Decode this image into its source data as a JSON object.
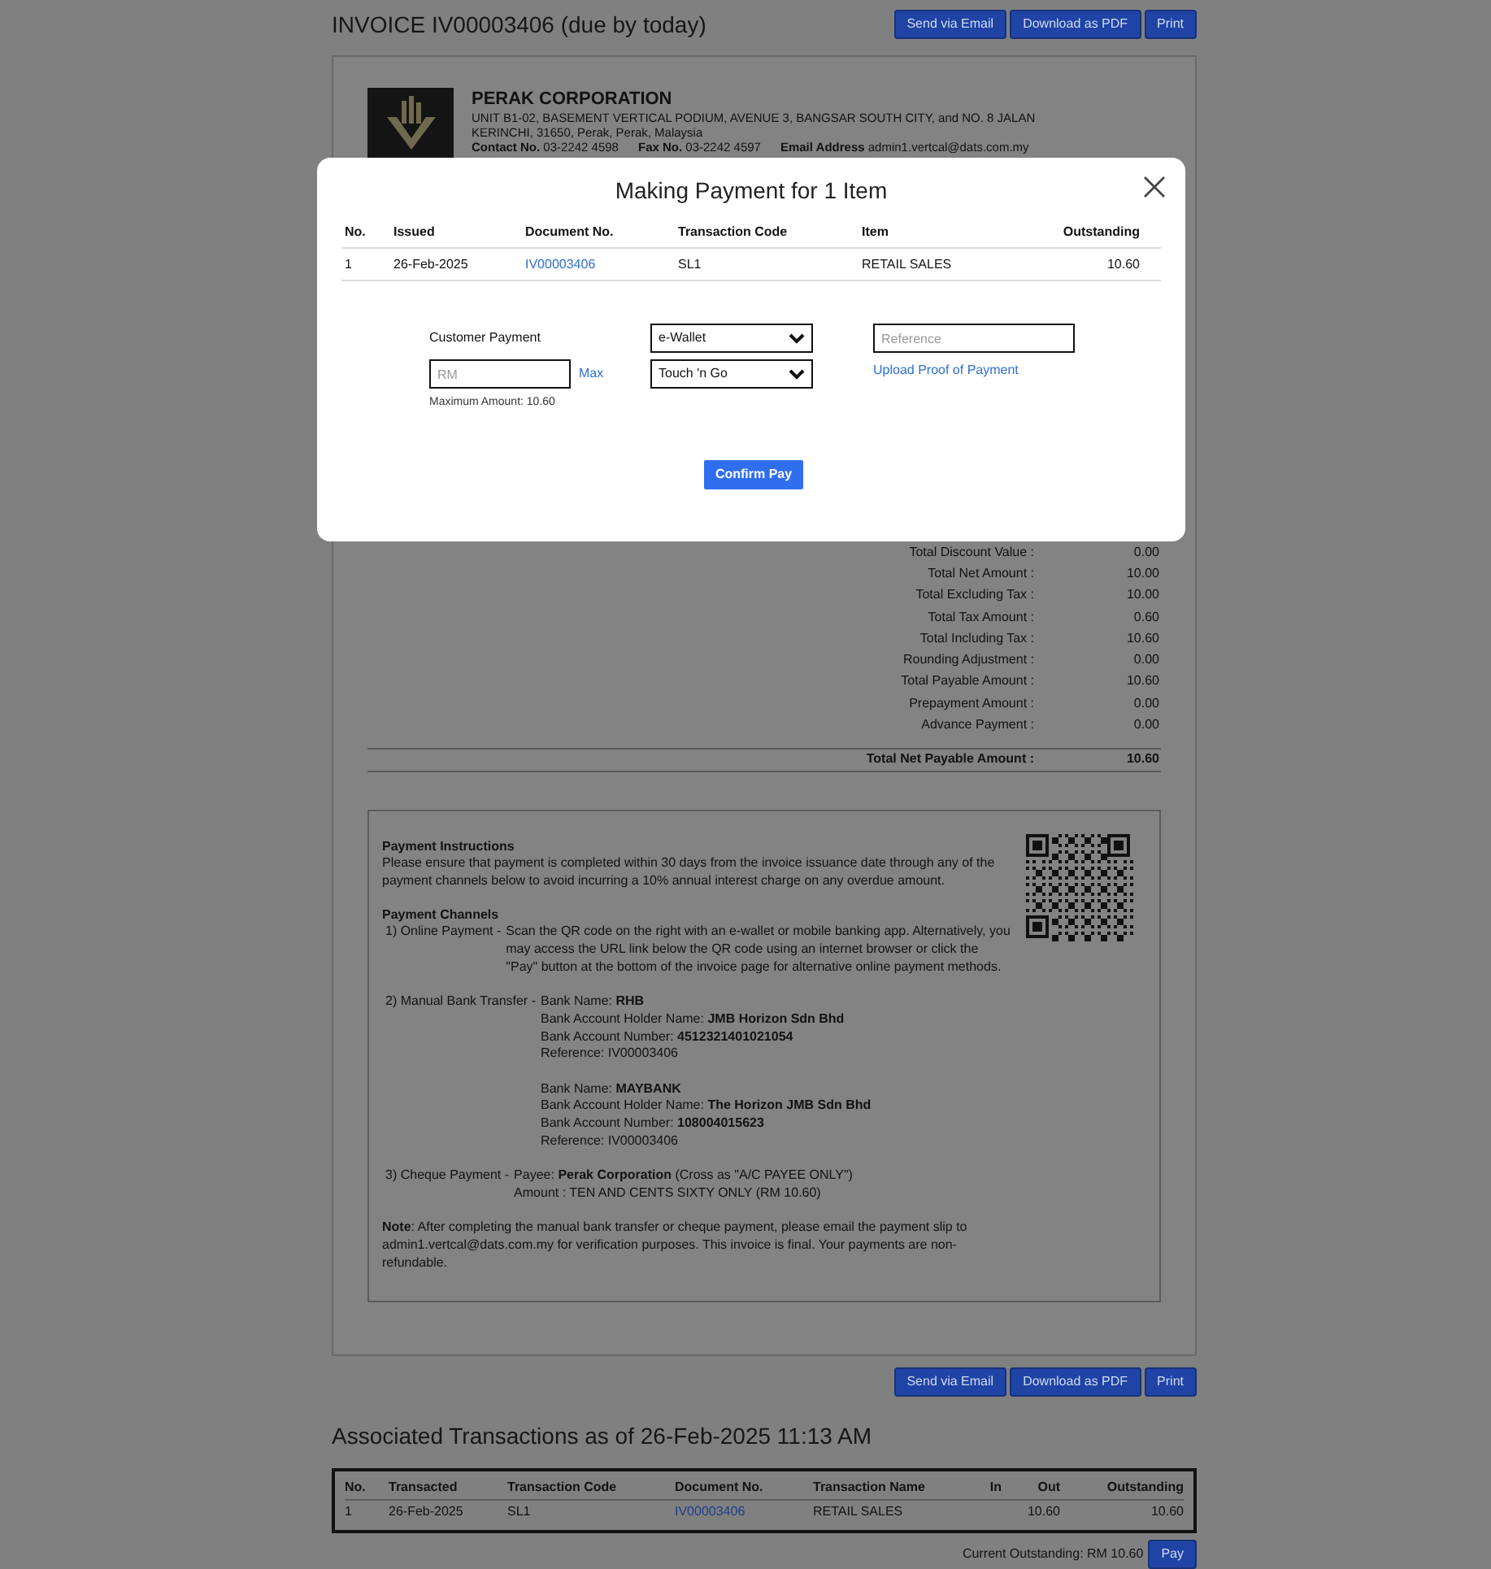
{
  "page_header": {
    "title": "INVOICE IV00003406 (due by today)",
    "actions": [
      "Send via Email",
      "Download as PDF",
      "Print"
    ]
  },
  "company": {
    "name": "PERAK CORPORATION",
    "address": "UNIT B1-02, BASEMENT VERTICAL PODIUM, AVENUE 3, BANGSAR SOUTH CITY, and NO. 8 JALAN KERINCHI, 31650, Perak, Perak, Malaysia",
    "contacts": [
      {
        "label": "Contact No.",
        "value": "03-2242 4598"
      },
      {
        "label": "Fax No.",
        "value": "03-2242 4597"
      },
      {
        "label": "Email Address",
        "value": "admin1.vertcal@dats.com.my"
      }
    ]
  },
  "totals": [
    {
      "kind": "line",
      "label": "Total Discount Value :",
      "value": "0.00"
    },
    {
      "kind": "line",
      "label": "Total Net Amount :",
      "value": "10.00"
    },
    {
      "kind": "line",
      "label": "Total Excluding Tax :",
      "value": "10.00"
    },
    {
      "kind": "line",
      "label": "Total Tax Amount :",
      "value": "0.60"
    },
    {
      "kind": "line",
      "label": "Total Including Tax :",
      "value": "10.60"
    },
    {
      "kind": "line",
      "label": "Rounding Adjustment :",
      "value": "0.00"
    },
    {
      "kind": "line",
      "label": "Total Payable Amount :",
      "value": "10.60"
    },
    {
      "kind": "line",
      "label": "Prepayment Amount :",
      "value": "0.00"
    },
    {
      "kind": "line",
      "label": "Advance Payment :",
      "value": "0.00"
    },
    {
      "kind": "grand",
      "label": "Total Net Payable Amount :",
      "value": "10.60"
    }
  ],
  "payment_instructions": {
    "title": "Payment Instructions",
    "text": "Please ensure that payment is completed within 30 days from the invoice issuance date through any of the payment channels below to avoid incurring a 10% annual interest charge on any overdue amount.",
    "channels_title": "Payment Channels",
    "channels": [
      {
        "label": "1) Online Payment -",
        "blocks": [
          [
            "Scan the QR code on the right with an e-wallet or mobile banking app. Alternatively, you may access the URL link below the QR code using an internet browser or click the \"Pay\" button at the bottom of the invoice page for alternative online payment methods."
          ]
        ]
      },
      {
        "label": "2) Manual Bank Transfer -",
        "blocks": [
          [
            "Bank Name: **RHB**",
            "Bank Account Holder Name: **JMB Horizon Sdn Bhd**",
            "Bank Account Number: **4512321401021054**",
            "Reference: IV00003406"
          ],
          [
            "Bank Name: **MAYBANK**",
            "Bank Account Holder Name: **The Horizon JMB Sdn Bhd**",
            "Bank Account Number: **108004015623**",
            "Reference: IV00003406"
          ]
        ]
      },
      {
        "label": "3) Cheque Payment -",
        "blocks": [
          [
            "Payee: **Perak Corporation** (Cross as \"A/C PAYEE ONLY\")",
            "Amount : TEN AND CENTS SIXTY ONLY (RM 10.60)"
          ]
        ]
      }
    ],
    "note": "**Note**: After completing the manual bank transfer or cheque payment, please email the payment slip to admin1.vertcal@dats.com.my for verification purposes. This invoice is final. Your payments are non-refundable."
  },
  "footer_actions": [
    "Send via Email",
    "Download as PDF",
    "Print"
  ],
  "associated": {
    "title": "Associated Transactions as of 26-Feb-2025 11:13 AM",
    "columns": [
      "No.",
      "Transacted",
      "Transaction Code",
      "Document No.",
      "Transaction Name",
      "In",
      "Out",
      "Outstanding"
    ],
    "rows": [
      [
        "1",
        "26-Feb-2025",
        "SL1",
        "IV00003406",
        "RETAIL SALES",
        null,
        "10.60",
        "10.60"
      ]
    ]
  },
  "current_outstanding": "Current Outstanding: RM 10.60",
  "pay_button": "Pay",
  "modal": {
    "title": "Making Payment for 1 Item",
    "columns": [
      "No.",
      "Issued",
      "Document No.",
      "Transaction Code",
      "Item",
      "Outstanding"
    ],
    "rows": [
      [
        "1",
        "26-Feb-2025",
        "IV00003406",
        "SL1",
        "RETAIL SALES",
        "10.60"
      ]
    ],
    "customer_payment_label": "Customer Payment",
    "amount_placeholder": "RM",
    "max_link": "Max",
    "max_hint": "Maximum Amount: 10.60",
    "method": "e-Wallet",
    "provider": "Touch 'n Go",
    "reference_placeholder": "Reference",
    "upload_link": "Upload Proof of Payment",
    "confirm_button": "Confirm Pay"
  }
}
